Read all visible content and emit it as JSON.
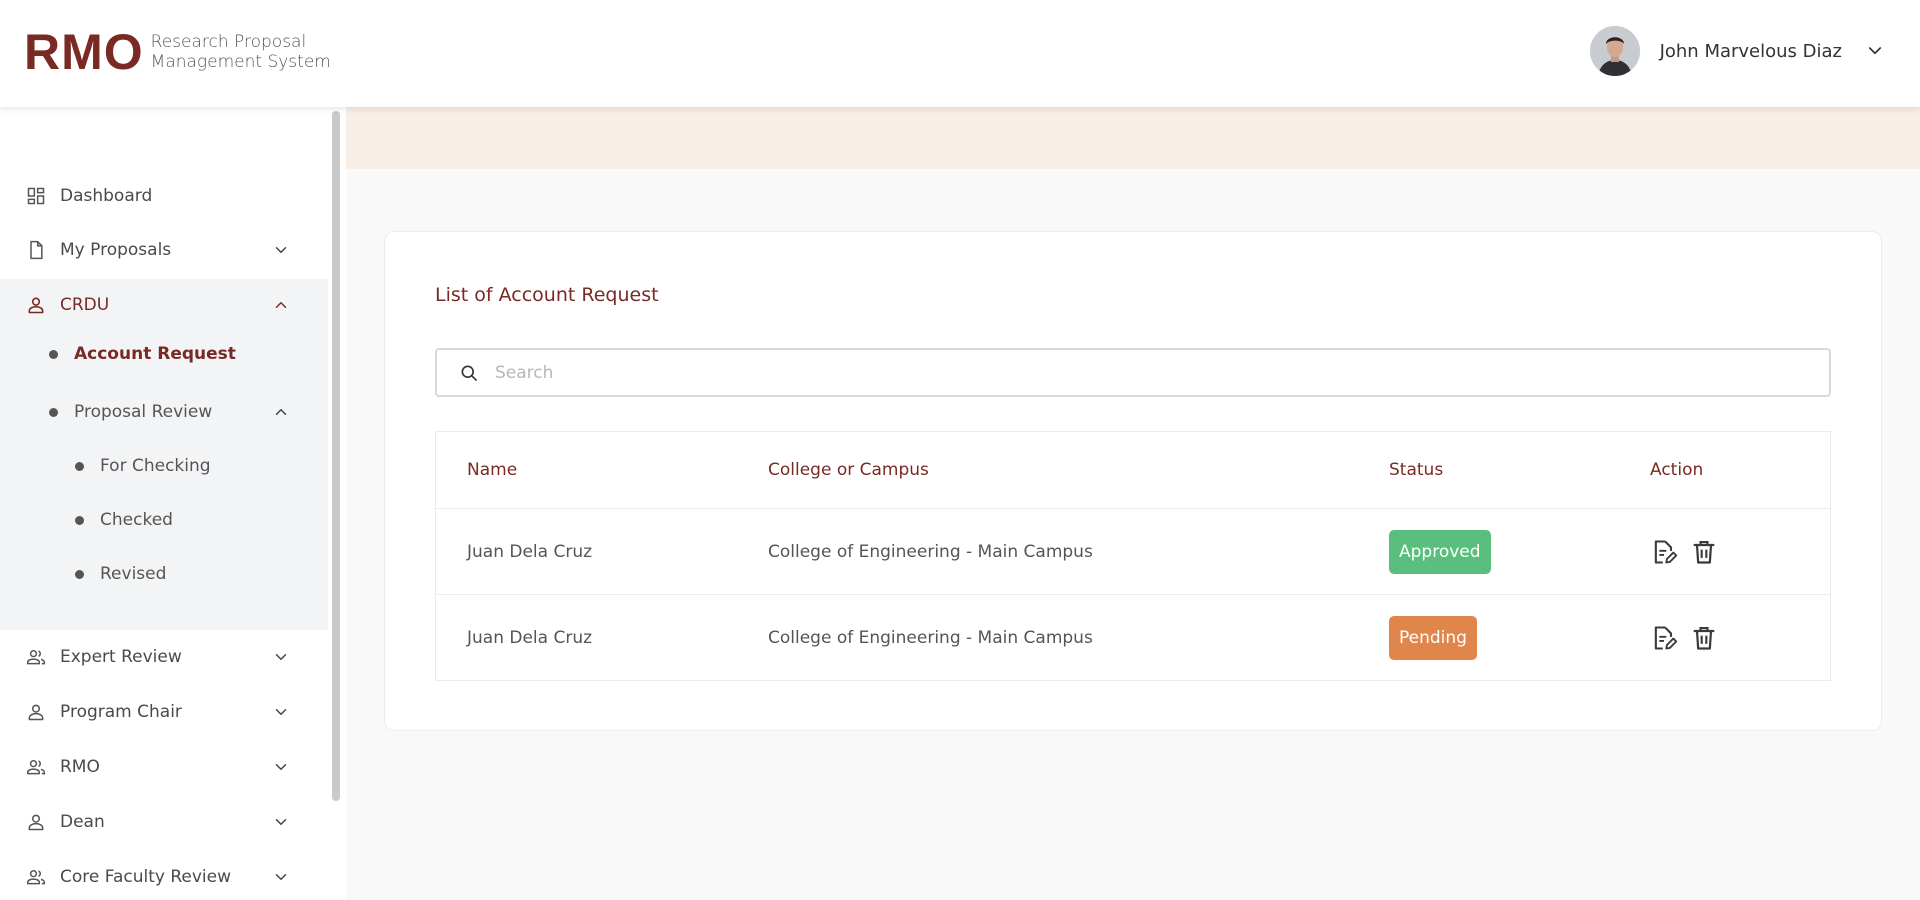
{
  "brand": {
    "logo_text": "RMO",
    "line1": "Research Proposal",
    "line2": "Management System"
  },
  "user": {
    "name": "John Marvelous Diaz"
  },
  "sidebar": {
    "items": [
      {
        "label": "Dashboard",
        "icon": "dashboard-icon"
      },
      {
        "label": "My Proposals",
        "icon": "document-icon"
      },
      {
        "label": "CRDU",
        "icon": "person-icon"
      },
      {
        "label": "Expert Review",
        "icon": "people-icon"
      },
      {
        "label": "Program Chair",
        "icon": "person-icon"
      },
      {
        "label": "RMO",
        "icon": "people-icon"
      },
      {
        "label": "Dean",
        "icon": "person-icon"
      },
      {
        "label": "Core Faculty Review",
        "icon": "people-icon"
      }
    ],
    "crdu_sub": {
      "account_request": "Account Request",
      "proposal_review": "Proposal Review",
      "proposal_review_children": [
        "For Checking",
        "Checked",
        "Revised"
      ]
    }
  },
  "main": {
    "title": "List of Account Request",
    "search_placeholder": "Search",
    "table": {
      "headers": [
        "Name",
        "College or Campus",
        "Status",
        "Action"
      ],
      "rows": [
        {
          "name": "Juan Dela Cruz",
          "college": "College of Engineering - Main Campus",
          "status": "Approved"
        },
        {
          "name": "Juan Dela Cruz",
          "college": "College of Engineering - Main Campus",
          "status": "Pending"
        }
      ]
    }
  },
  "colors": {
    "brand": "#7a2a25",
    "approved": "#58c07c",
    "pending": "#e0864a",
    "banner": "#f8eee6"
  }
}
